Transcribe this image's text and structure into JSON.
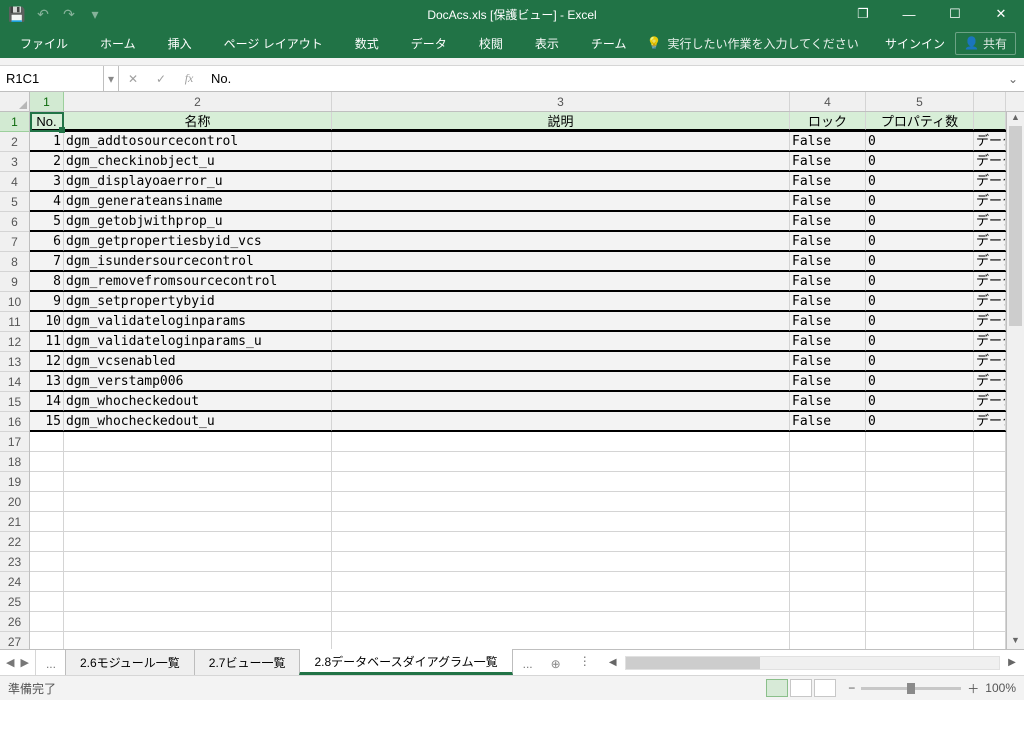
{
  "title": "DocAcs.xls  [保護ビュー] - Excel",
  "qat": {
    "undo": "↶",
    "redo": "↷",
    "more": "▾"
  },
  "win": {
    "mode": "❐",
    "min": "—",
    "max": "☐",
    "close": "✕"
  },
  "ribbon": {
    "file": "ファイル",
    "tabs": [
      "ホーム",
      "挿入",
      "ページ レイアウト",
      "数式",
      "データ",
      "校閲",
      "表示",
      "チーム"
    ],
    "tell_me": "実行したい作業を入力してください",
    "signin": "サインイン",
    "share": "共有"
  },
  "formula": {
    "namebox": "R1C1",
    "content": "No."
  },
  "columns": [
    "1",
    "2",
    "3",
    "4",
    "5",
    ""
  ],
  "headers": {
    "c1": "No.",
    "c2": "名称",
    "c3": "説明",
    "c4": "ロック",
    "c5": "プロパティ数",
    "c6": ""
  },
  "rows": [
    {
      "no": "1",
      "name": "dgm_addtosourcecontrol",
      "desc": "",
      "lock": "False",
      "props": "0",
      "ex": "データ"
    },
    {
      "no": "2",
      "name": "dgm_checkinobject_u",
      "desc": "",
      "lock": "False",
      "props": "0",
      "ex": "データ"
    },
    {
      "no": "3",
      "name": "dgm_displayoaerror_u",
      "desc": "",
      "lock": "False",
      "props": "0",
      "ex": "データ"
    },
    {
      "no": "4",
      "name": "dgm_generateansiname",
      "desc": "",
      "lock": "False",
      "props": "0",
      "ex": "データ"
    },
    {
      "no": "5",
      "name": "dgm_getobjwithprop_u",
      "desc": "",
      "lock": "False",
      "props": "0",
      "ex": "データ"
    },
    {
      "no": "6",
      "name": "dgm_getpropertiesbyid_vcs",
      "desc": "",
      "lock": "False",
      "props": "0",
      "ex": "データ"
    },
    {
      "no": "7",
      "name": "dgm_isundersourcecontrol",
      "desc": "",
      "lock": "False",
      "props": "0",
      "ex": "データ"
    },
    {
      "no": "8",
      "name": "dgm_removefromsourcecontrol",
      "desc": "",
      "lock": "False",
      "props": "0",
      "ex": "データ"
    },
    {
      "no": "9",
      "name": "dgm_setpropertybyid",
      "desc": "",
      "lock": "False",
      "props": "0",
      "ex": "データ"
    },
    {
      "no": "10",
      "name": "dgm_validateloginparams",
      "desc": "",
      "lock": "False",
      "props": "0",
      "ex": "データ"
    },
    {
      "no": "11",
      "name": "dgm_validateloginparams_u",
      "desc": "",
      "lock": "False",
      "props": "0",
      "ex": "データ"
    },
    {
      "no": "12",
      "name": "dgm_vcsenabled",
      "desc": "",
      "lock": "False",
      "props": "0",
      "ex": "データ"
    },
    {
      "no": "13",
      "name": "dgm_verstamp006",
      "desc": "",
      "lock": "False",
      "props": "0",
      "ex": "データ"
    },
    {
      "no": "14",
      "name": "dgm_whocheckedout",
      "desc": "",
      "lock": "False",
      "props": "0",
      "ex": "データ"
    },
    {
      "no": "15",
      "name": "dgm_whocheckedout_u",
      "desc": "",
      "lock": "False",
      "props": "0",
      "ex": "データ"
    }
  ],
  "row_labels": [
    "1",
    "2",
    "3",
    "4",
    "5",
    "6",
    "7",
    "8",
    "9",
    "10",
    "11",
    "12",
    "13",
    "14",
    "15",
    "16",
    "17",
    "18",
    "19",
    "20",
    "21",
    "22",
    "23",
    "24",
    "25",
    "26",
    "27"
  ],
  "sheets": {
    "more_left": "...",
    "tabs": [
      "2.6モジュール一覧",
      "2.7ビュー一覧",
      "2.8データベースダイアグラム一覧"
    ],
    "active_index": 2,
    "more_right": "...",
    "add": "⊕"
  },
  "status": {
    "ready": "準備完了",
    "zoom": "100%"
  }
}
